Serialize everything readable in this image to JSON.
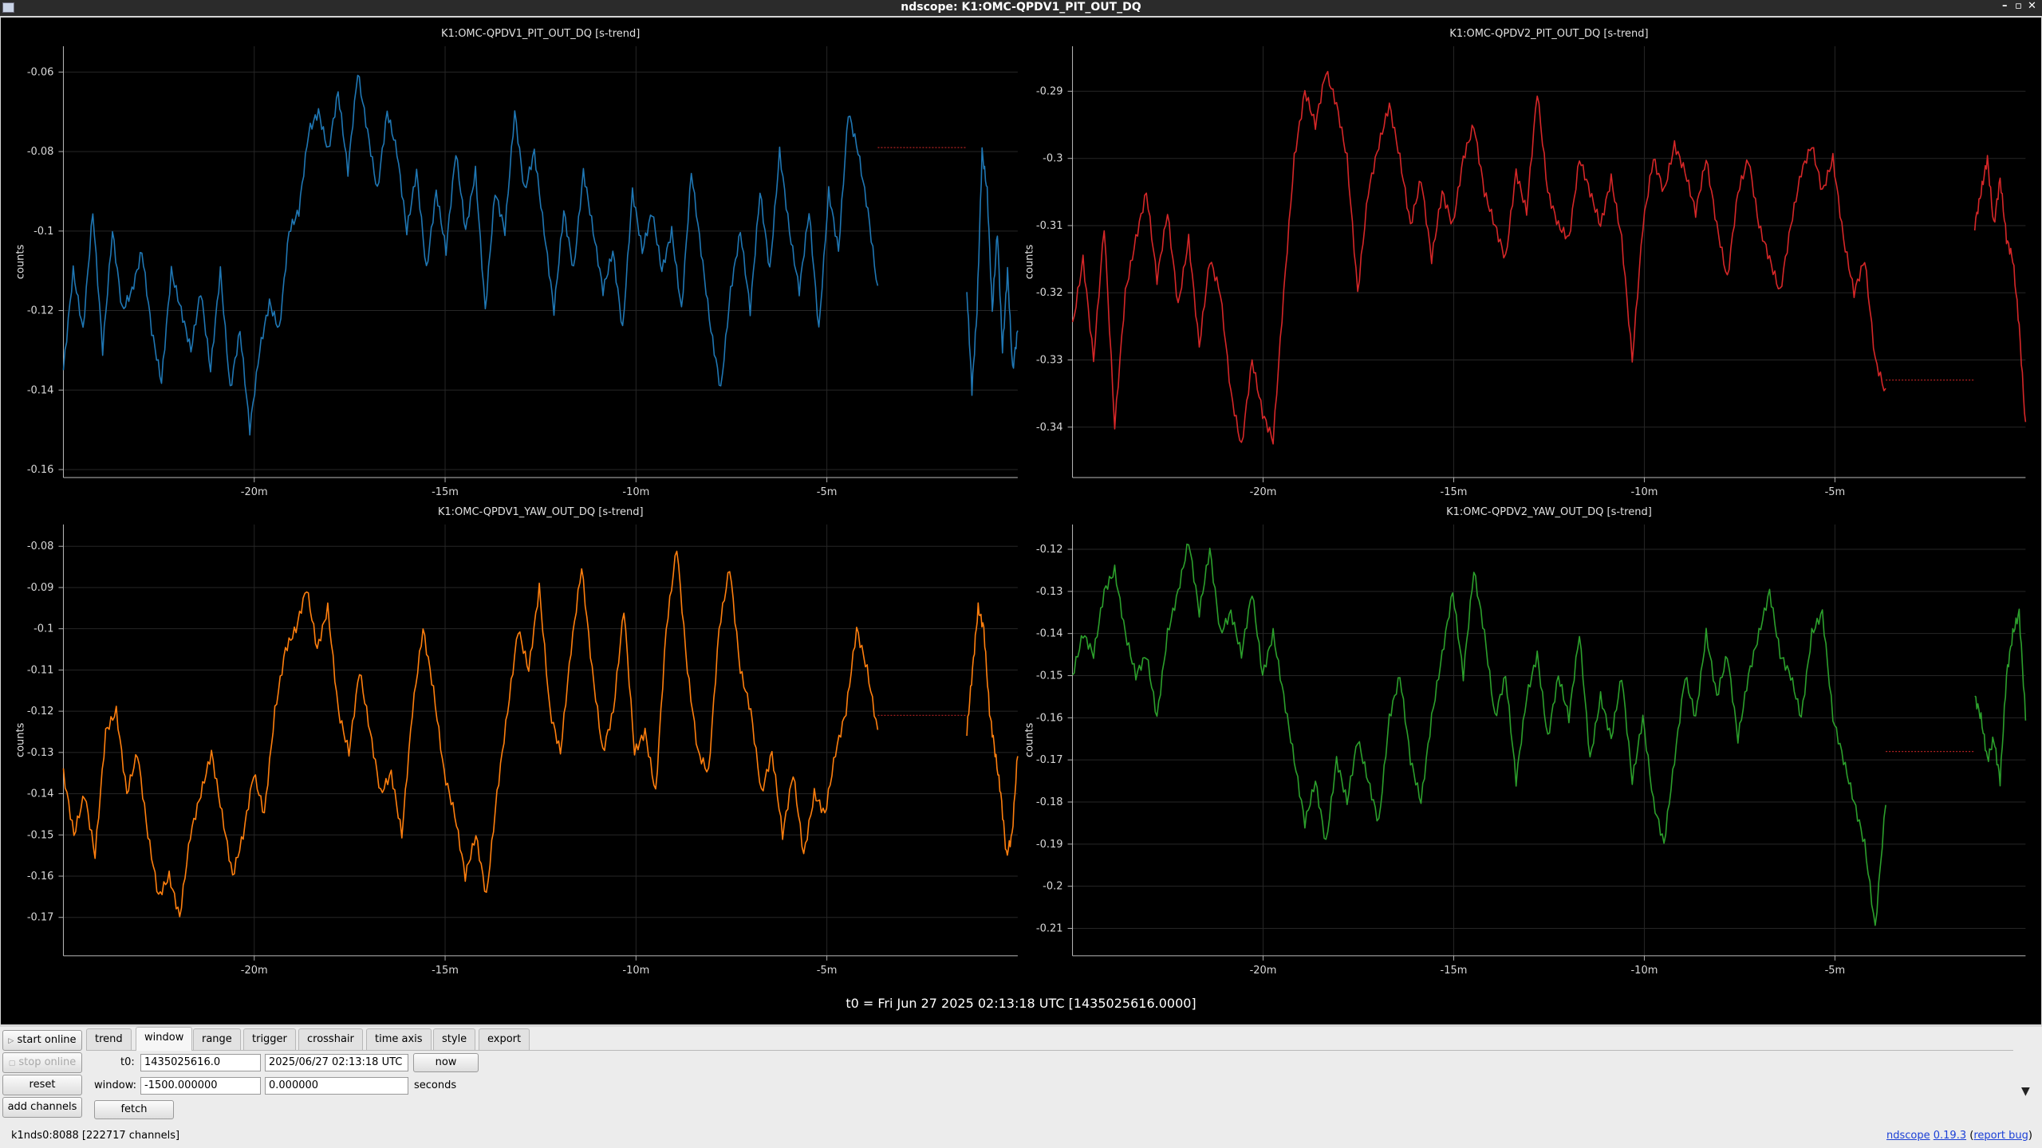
{
  "window": {
    "title": "ndscope: K1:OMC-QPDV1_PIT_OUT_DQ",
    "buttons": [
      "–",
      "▫",
      "✕"
    ]
  },
  "t0_label": "t0 = Fri Jun 27 2025 02:13:18 UTC [1435025616.0000]",
  "chart_data": [
    {
      "type": "line",
      "title": "K1:OMC-QPDV1_PIT_OUT_DQ [s-trend]",
      "ylabel": "counts",
      "color": "#1f77b4",
      "xlim": [
        -1500,
        0
      ],
      "ylim": [
        -0.162,
        -0.0535
      ],
      "x_ticks": [
        {
          "v": -1200,
          "label": "-20m"
        },
        {
          "v": -900,
          "label": "-15m"
        },
        {
          "v": -600,
          "label": "-10m"
        },
        {
          "v": -300,
          "label": "-5m"
        }
      ],
      "y_ticks": [
        {
          "v": -0.06,
          "label": "-0.06"
        },
        {
          "v": -0.08,
          "label": "-0.08"
        },
        {
          "v": -0.1,
          "label": "-0.1"
        },
        {
          "v": -0.12,
          "label": "-0.12"
        },
        {
          "v": -0.14,
          "label": "-0.14"
        },
        {
          "v": -0.16,
          "label": "-0.16"
        }
      ],
      "series": [
        {
          "segment": [
            -1500,
            -220
          ],
          "values": [
            -0.135,
            -0.11,
            -0.125,
            -0.095,
            -0.13,
            -0.1,
            -0.12,
            -0.115,
            -0.105,
            -0.125,
            -0.138,
            -0.11,
            -0.12,
            -0.13,
            -0.115,
            -0.135,
            -0.11,
            -0.14,
            -0.125,
            -0.15,
            -0.13,
            -0.118,
            -0.125,
            -0.1,
            -0.095,
            -0.075,
            -0.07,
            -0.08,
            -0.065,
            -0.085,
            -0.06,
            -0.075,
            -0.09,
            -0.07,
            -0.08,
            -0.1,
            -0.085,
            -0.11,
            -0.09,
            -0.105,
            -0.08,
            -0.1,
            -0.085,
            -0.12,
            -0.09,
            -0.1,
            -0.07,
            -0.09,
            -0.08,
            -0.1,
            -0.12,
            -0.095,
            -0.11,
            -0.085,
            -0.1,
            -0.115,
            -0.105,
            -0.125,
            -0.09,
            -0.105,
            -0.095,
            -0.11,
            -0.1,
            -0.12,
            -0.085,
            -0.105,
            -0.125,
            -0.14,
            -0.115,
            -0.1,
            -0.12,
            -0.09,
            -0.11,
            -0.08,
            -0.1,
            -0.115,
            -0.095,
            -0.125,
            -0.09,
            -0.105,
            -0.07,
            -0.08,
            -0.095,
            -0.115
          ]
        },
        {
          "segment": [
            -220,
            -80
          ],
          "flat": -0.079,
          "style": "dashed-red"
        },
        {
          "segment": [
            -80,
            0
          ],
          "values": [
            -0.115,
            -0.14,
            -0.12,
            -0.08,
            -0.09,
            -0.12,
            -0.1,
            -0.13,
            -0.11,
            -0.135,
            -0.125
          ]
        }
      ]
    },
    {
      "type": "line",
      "title": "K1:OMC-QPDV2_PIT_OUT_DQ [s-trend]",
      "ylabel": "counts",
      "color": "#d62728",
      "xlim": [
        -1500,
        0
      ],
      "ylim": [
        -0.3475,
        -0.2833
      ],
      "x_ticks": [
        {
          "v": -1200,
          "label": "-20m"
        },
        {
          "v": -900,
          "label": "-15m"
        },
        {
          "v": -600,
          "label": "-10m"
        },
        {
          "v": -300,
          "label": "-5m"
        }
      ],
      "y_ticks": [
        {
          "v": -0.29,
          "label": "-0.29"
        },
        {
          "v": -0.3,
          "label": "-0.3"
        },
        {
          "v": -0.31,
          "label": "-0.31"
        },
        {
          "v": -0.32,
          "label": "-0.32"
        },
        {
          "v": -0.33,
          "label": "-0.33"
        },
        {
          "v": -0.34,
          "label": "-0.34"
        }
      ],
      "series": [
        {
          "segment": [
            -1500,
            -220
          ],
          "values": [
            -0.325,
            -0.315,
            -0.33,
            -0.31,
            -0.34,
            -0.32,
            -0.312,
            -0.305,
            -0.318,
            -0.308,
            -0.322,
            -0.312,
            -0.328,
            -0.315,
            -0.32,
            -0.335,
            -0.343,
            -0.33,
            -0.338,
            -0.342,
            -0.32,
            -0.3,
            -0.29,
            -0.295,
            -0.287,
            -0.292,
            -0.3,
            -0.32,
            -0.305,
            -0.298,
            -0.292,
            -0.3,
            -0.31,
            -0.303,
            -0.315,
            -0.305,
            -0.31,
            -0.3,
            -0.295,
            -0.305,
            -0.31,
            -0.315,
            -0.302,
            -0.308,
            -0.29,
            -0.305,
            -0.31,
            -0.312,
            -0.3,
            -0.305,
            -0.31,
            -0.303,
            -0.312,
            -0.33,
            -0.31,
            -0.3,
            -0.305,
            -0.298,
            -0.302,
            -0.308,
            -0.3,
            -0.31,
            -0.318,
            -0.305,
            -0.3,
            -0.31,
            -0.315,
            -0.32,
            -0.31,
            -0.302,
            -0.298,
            -0.305,
            -0.3,
            -0.312,
            -0.32,
            -0.315,
            -0.33,
            -0.335
          ]
        },
        {
          "segment": [
            -220,
            -80
          ],
          "flat": -0.333,
          "style": "dashed-red"
        },
        {
          "segment": [
            -80,
            0
          ],
          "values": [
            -0.31,
            -0.305,
            -0.3,
            -0.31,
            -0.303,
            -0.312,
            -0.315,
            -0.325,
            -0.34
          ]
        }
      ]
    },
    {
      "type": "line",
      "title": "K1:OMC-QPDV1_YAW_OUT_DQ [s-trend]",
      "ylabel": "counts",
      "color": "#ff7f0e",
      "xlim": [
        -1500,
        0
      ],
      "ylim": [
        -0.1793,
        -0.0747
      ],
      "x_ticks": [
        {
          "v": -1200,
          "label": "-20m"
        },
        {
          "v": -900,
          "label": "-15m"
        },
        {
          "v": -600,
          "label": "-10m"
        },
        {
          "v": -300,
          "label": "-5m"
        }
      ],
      "y_ticks": [
        {
          "v": -0.08,
          "label": "-0.08"
        },
        {
          "v": -0.09,
          "label": "-0.09"
        },
        {
          "v": -0.1,
          "label": "-0.1"
        },
        {
          "v": -0.11,
          "label": "-0.11"
        },
        {
          "v": -0.12,
          "label": "-0.12"
        },
        {
          "v": -0.13,
          "label": "-0.13"
        },
        {
          "v": -0.14,
          "label": "-0.14"
        },
        {
          "v": -0.15,
          "label": "-0.15"
        },
        {
          "v": -0.16,
          "label": "-0.16"
        },
        {
          "v": -0.17,
          "label": "-0.17"
        }
      ],
      "series": [
        {
          "segment": [
            -1500,
            -220
          ],
          "values": [
            -0.135,
            -0.15,
            -0.14,
            -0.155,
            -0.125,
            -0.12,
            -0.14,
            -0.13,
            -0.15,
            -0.165,
            -0.16,
            -0.17,
            -0.15,
            -0.14,
            -0.13,
            -0.145,
            -0.16,
            -0.15,
            -0.135,
            -0.145,
            -0.12,
            -0.105,
            -0.1,
            -0.09,
            -0.105,
            -0.095,
            -0.12,
            -0.13,
            -0.11,
            -0.125,
            -0.14,
            -0.135,
            -0.15,
            -0.12,
            -0.1,
            -0.115,
            -0.135,
            -0.145,
            -0.16,
            -0.15,
            -0.165,
            -0.14,
            -0.12,
            -0.1,
            -0.11,
            -0.09,
            -0.12,
            -0.13,
            -0.105,
            -0.085,
            -0.11,
            -0.13,
            -0.12,
            -0.095,
            -0.13,
            -0.125,
            -0.14,
            -0.1,
            -0.08,
            -0.11,
            -0.13,
            -0.135,
            -0.1,
            -0.085,
            -0.11,
            -0.12,
            -0.14,
            -0.13,
            -0.15,
            -0.135,
            -0.155,
            -0.14,
            -0.145,
            -0.13,
            -0.12,
            -0.1,
            -0.11,
            -0.125
          ]
        },
        {
          "segment": [
            -220,
            -80
          ],
          "flat": -0.121,
          "style": "dashed-red"
        },
        {
          "segment": [
            -80,
            0
          ],
          "values": [
            -0.125,
            -0.11,
            -0.095,
            -0.1,
            -0.12,
            -0.13,
            -0.14,
            -0.155,
            -0.15,
            -0.13
          ]
        }
      ]
    },
    {
      "type": "line",
      "title": "K1:OMC-QPDV2_YAW_OUT_DQ [s-trend]",
      "ylabel": "counts",
      "color": "#2ca02c",
      "xlim": [
        -1500,
        0
      ],
      "ylim": [
        -0.2165,
        -0.1141
      ],
      "x_ticks": [
        {
          "v": -1200,
          "label": "-20m"
        },
        {
          "v": -900,
          "label": "-15m"
        },
        {
          "v": -600,
          "label": "-10m"
        },
        {
          "v": -300,
          "label": "-5m"
        }
      ],
      "y_ticks": [
        {
          "v": -0.12,
          "label": "-0.12"
        },
        {
          "v": -0.13,
          "label": "-0.13"
        },
        {
          "v": -0.14,
          "label": "-0.14"
        },
        {
          "v": -0.15,
          "label": "-0.15"
        },
        {
          "v": -0.16,
          "label": "-0.16"
        },
        {
          "v": -0.17,
          "label": "-0.17"
        },
        {
          "v": -0.18,
          "label": "-0.18"
        },
        {
          "v": -0.19,
          "label": "-0.19"
        },
        {
          "v": -0.2,
          "label": "-0.2"
        },
        {
          "v": -0.21,
          "label": "-0.21"
        }
      ],
      "series": [
        {
          "segment": [
            -1500,
            -220
          ],
          "values": [
            -0.15,
            -0.14,
            -0.145,
            -0.13,
            -0.125,
            -0.14,
            -0.15,
            -0.145,
            -0.16,
            -0.14,
            -0.13,
            -0.118,
            -0.135,
            -0.12,
            -0.14,
            -0.135,
            -0.145,
            -0.13,
            -0.15,
            -0.14,
            -0.155,
            -0.17,
            -0.185,
            -0.175,
            -0.19,
            -0.17,
            -0.18,
            -0.165,
            -0.175,
            -0.185,
            -0.16,
            -0.15,
            -0.17,
            -0.18,
            -0.16,
            -0.145,
            -0.13,
            -0.15,
            -0.125,
            -0.14,
            -0.16,
            -0.15,
            -0.175,
            -0.155,
            -0.145,
            -0.165,
            -0.15,
            -0.16,
            -0.14,
            -0.17,
            -0.155,
            -0.165,
            -0.15,
            -0.175,
            -0.16,
            -0.18,
            -0.19,
            -0.17,
            -0.15,
            -0.16,
            -0.14,
            -0.155,
            -0.145,
            -0.165,
            -0.15,
            -0.14,
            -0.13,
            -0.145,
            -0.15,
            -0.16,
            -0.14,
            -0.135,
            -0.16,
            -0.17,
            -0.18,
            -0.19,
            -0.21,
            -0.18
          ]
        },
        {
          "segment": [
            -220,
            -80
          ],
          "flat": -0.168,
          "style": "dashed-red"
        },
        {
          "segment": [
            -80,
            0
          ],
          "values": [
            -0.155,
            -0.16,
            -0.17,
            -0.165,
            -0.175,
            -0.15,
            -0.14,
            -0.135,
            -0.16
          ]
        }
      ]
    }
  ],
  "controls": {
    "start_online": "start online",
    "stop_online": "stop online",
    "reset": "reset",
    "add_channels": "add channels",
    "tabs": [
      "trend",
      "window",
      "range",
      "trigger",
      "crosshair",
      "time axis",
      "style",
      "export"
    ],
    "t0_label": "t0:",
    "t0_gps": "1435025616.0",
    "t0_utc": "2025/06/27 02:13:18 UTC",
    "now_button": "now",
    "window_label": "window:",
    "window_start": "-1500.000000",
    "window_end": "0.000000",
    "seconds_label": "seconds",
    "fetch_button": "fetch"
  },
  "status": {
    "server": "k1nds0:8088  [222717 channels]",
    "app_link": "ndscope",
    "version_link": "0.19.3",
    "report_bug_link": "report bug"
  }
}
